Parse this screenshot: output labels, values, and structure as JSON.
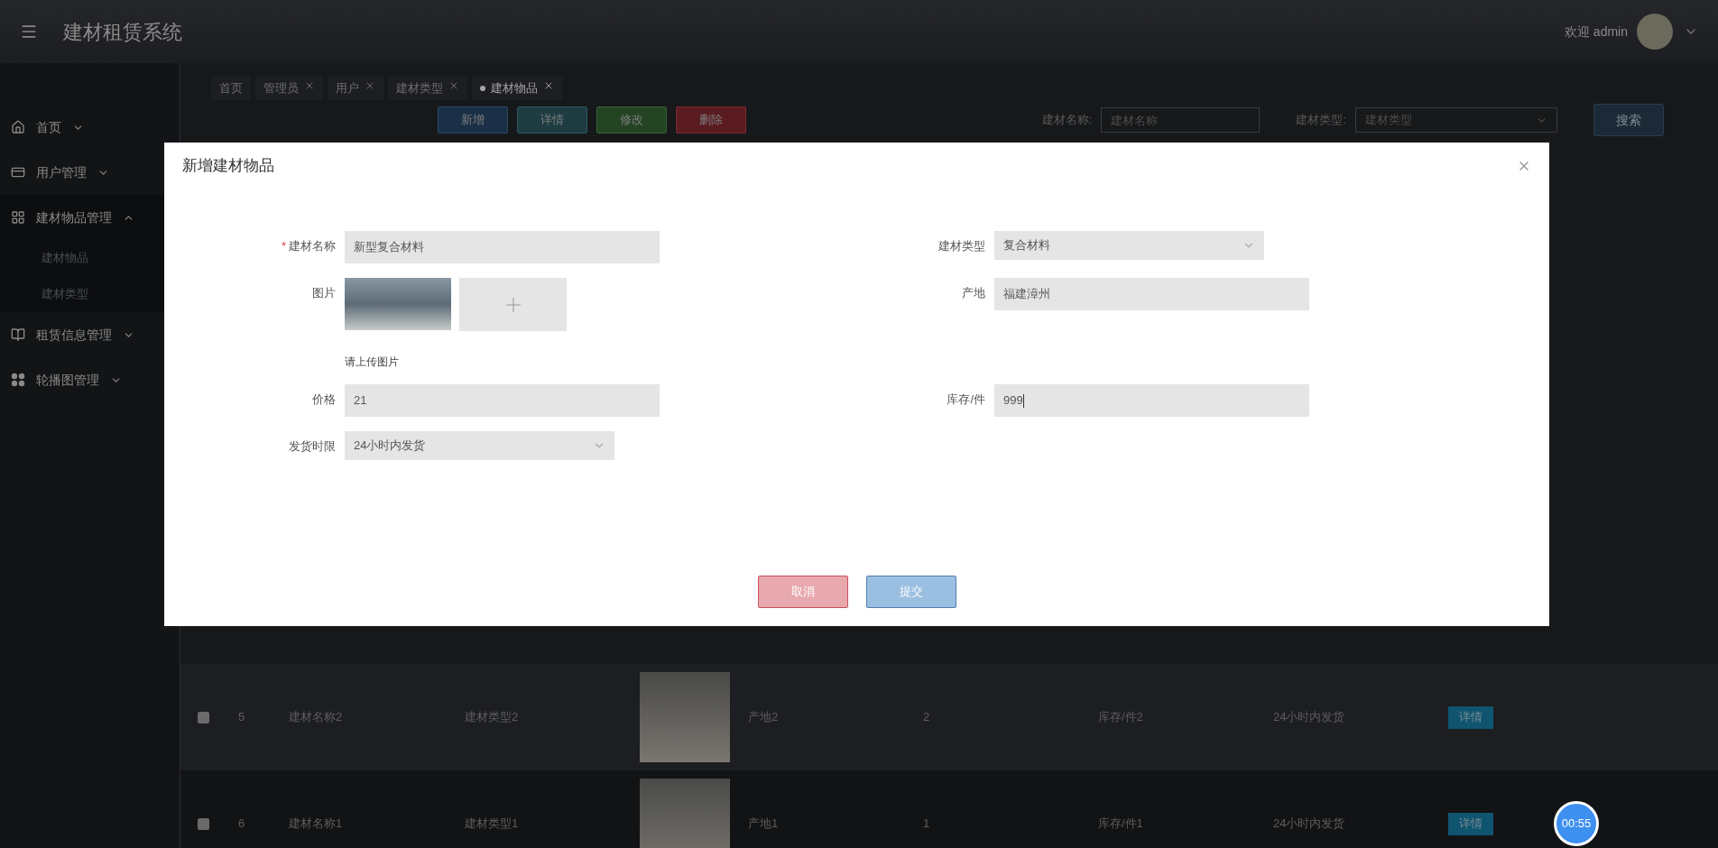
{
  "header": {
    "title": "建材租赁系统",
    "welcome": "欢迎 admin"
  },
  "sidebar": {
    "items": [
      {
        "label": "首页",
        "expanded": false
      },
      {
        "label": "用户管理",
        "expanded": false
      },
      {
        "label": "建材物品管理",
        "expanded": true,
        "children": [
          {
            "label": "建材物品"
          },
          {
            "label": "建材类型"
          }
        ]
      },
      {
        "label": "租赁信息管理",
        "expanded": false
      },
      {
        "label": "轮播图管理",
        "expanded": false
      }
    ]
  },
  "tabs": [
    {
      "label": "首页",
      "closable": false,
      "selected": false
    },
    {
      "label": "管理员",
      "closable": true,
      "selected": false
    },
    {
      "label": "用户",
      "closable": true,
      "selected": false
    },
    {
      "label": "建材类型",
      "closable": true,
      "selected": false
    },
    {
      "label": "建材物品",
      "closable": true,
      "selected": true
    }
  ],
  "toolbar": {
    "buttons": [
      {
        "label": "新增",
        "kind": "add"
      },
      {
        "label": "详情",
        "kind": "detail"
      },
      {
        "label": "修改",
        "kind": "edit"
      },
      {
        "label": "删除",
        "kind": "delete"
      }
    ]
  },
  "search": {
    "fields": [
      {
        "label": "建材名称:",
        "placeholder": "建材名称",
        "kind": "text"
      },
      {
        "label": "建材类型:",
        "placeholder": "建材类型",
        "kind": "select"
      }
    ],
    "button": "搜索"
  },
  "table": {
    "rows": [
      {
        "checked": false,
        "index": "5",
        "name": "建材名称2",
        "type": "建材类型2",
        "origin": "产地2",
        "price": "2",
        "stock": "库存/件2",
        "shipping": "24小时内发货",
        "action": "详情"
      },
      {
        "checked": false,
        "index": "6",
        "name": "建材名称1",
        "type": "建材类型1",
        "origin": "产地1",
        "price": "1",
        "stock": "库存/件1",
        "shipping": "24小时内发货",
        "action": "详情"
      }
    ]
  },
  "modal": {
    "title": "新增建材物品",
    "rows": [
      {
        "left": {
          "label": "建材名称",
          "kind": "text",
          "value": "新型复合材料",
          "required_mark": "*"
        },
        "right": {
          "label": "建材类型",
          "kind": "select",
          "value": "复合材料"
        }
      },
      {
        "left": {
          "label": "图片",
          "kind": "image",
          "hint": "请上传图片"
        },
        "right": {
          "label": "产地",
          "kind": "text",
          "value": "福建漳州"
        }
      },
      {
        "left": {
          "label": "价格",
          "kind": "text",
          "value": "21"
        },
        "right": {
          "label": "库存/件",
          "kind": "text",
          "value": "999",
          "focused": true
        }
      },
      {
        "left": {
          "label": "发货时限",
          "kind": "select",
          "value": "24小时内发货"
        }
      }
    ],
    "buttons": [
      {
        "label": "取消",
        "kind": "cancel"
      },
      {
        "label": "提交",
        "kind": "submit"
      }
    ]
  },
  "timer": "00:55"
}
